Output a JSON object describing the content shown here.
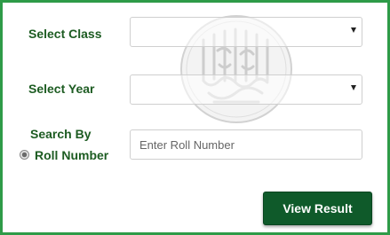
{
  "form": {
    "select_class": {
      "label": "Select Class",
      "value": ""
    },
    "select_year": {
      "label": "Select Year",
      "value": ""
    },
    "search_by": {
      "label": "Search By",
      "option_label": "Roll Number",
      "input_placeholder": "Enter Roll Number",
      "input_value": ""
    },
    "submit_label": "View Result"
  },
  "colors": {
    "frame_border": "#2e9b48",
    "label_text": "#1d5c22",
    "button_bg": "#0f5a2a",
    "button_text": "#ffffff"
  },
  "icons": {
    "watermark": "calligraphy-emblem-icon",
    "select_arrow": "caret-down-icon"
  }
}
